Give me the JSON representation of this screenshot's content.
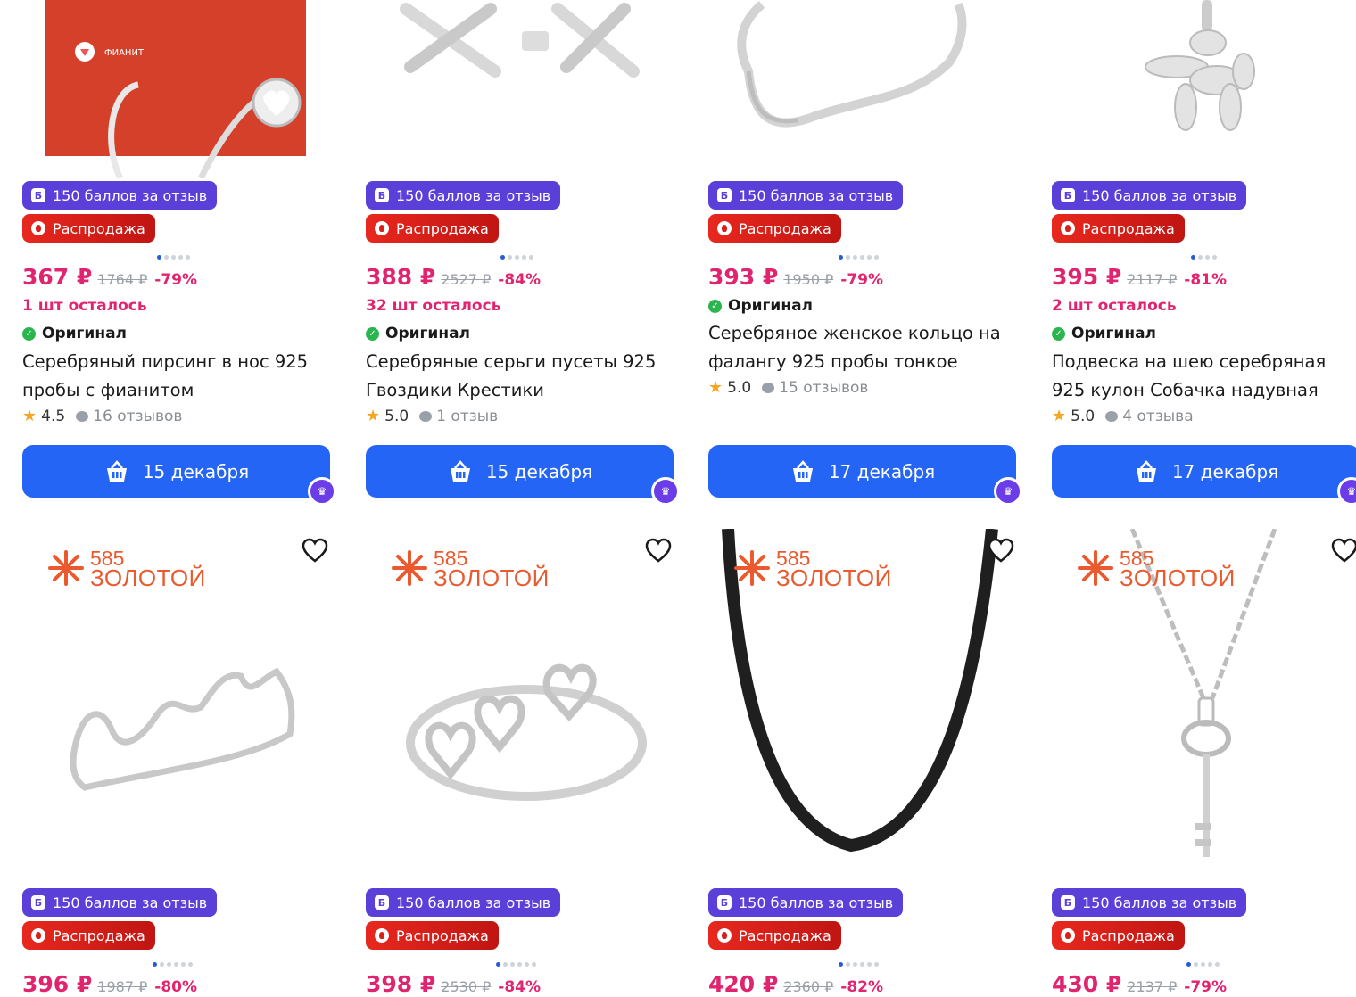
{
  "rows": [
    {
      "cards": [
        {
          "price": "367 ₽",
          "old": "1764 ₽",
          "disc": "-79%",
          "stock": "1 шт осталось",
          "original": "Оригинал",
          "title": "Серебряный пирсинг в нос 925 пробы с фианитом",
          "rating": "4.5",
          "reviews": "16 отзывов",
          "delivery": "15 декабря",
          "dots": 5,
          "active": 0,
          "packaging_text": "ФИАНИТ"
        },
        {
          "price": "388 ₽",
          "old": "2527 ₽",
          "disc": "-84%",
          "stock": "32 шт осталось",
          "original": "Оригинал",
          "title": "Серебряные серьги пусеты 925 Гвоздики Крестики",
          "rating": "5.0",
          "reviews": "1 отзыв",
          "delivery": "15 декабря",
          "dots": 5,
          "active": 0
        },
        {
          "price": "393 ₽",
          "old": "1950 ₽",
          "disc": "-79%",
          "stock": "",
          "original": "Оригинал",
          "title": "Серебряное женское кольцо на фалангу 925 пробы тонкое",
          "rating": "5.0",
          "reviews": "15 отзывов",
          "delivery": "17 декабря",
          "dots": 6,
          "active": 0
        },
        {
          "price": "395 ₽",
          "old": "2117 ₽",
          "disc": "-81%",
          "stock": "2 шт осталось",
          "original": "Оригинал",
          "title": "Подвеска на шею серебряная 925 кулон Собачка надувная",
          "rating": "5.0",
          "reviews": "4 отзыва",
          "delivery": "17 декабря",
          "dots": 4,
          "active": 0
        }
      ]
    },
    {
      "cards": [
        {
          "price": "396 ₽",
          "old": "1987 ₽",
          "disc": "-80%",
          "dots": 6,
          "active": 0
        },
        {
          "price": "398 ₽",
          "old": "2530 ₽",
          "disc": "-84%",
          "dots": 6,
          "active": 0
        },
        {
          "price": "420 ₽",
          "old": "2360 ₽",
          "disc": "-82%",
          "dots": 6,
          "active": 0
        },
        {
          "price": "430 ₽",
          "old": "2137 ₽",
          "disc": "-79%",
          "dots": 5,
          "active": 0
        }
      ]
    }
  ],
  "labels": {
    "points": "150 баллов за отзыв",
    "points_icon": "Б",
    "sale": "Распродажа"
  },
  "brand": {
    "num": "585",
    "name": "ЗОЛОТОЙ"
  },
  "colors": {
    "accent": "#2465f5",
    "price": "#e0246f",
    "points": "#5a3fd8",
    "sale": "#e8281e"
  }
}
